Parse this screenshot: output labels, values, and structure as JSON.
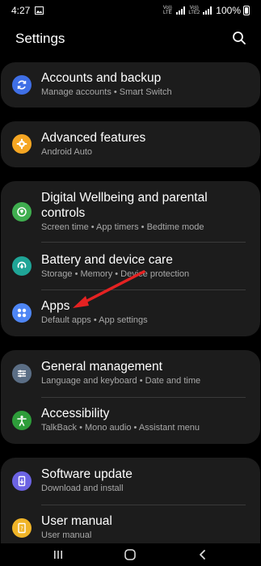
{
  "status": {
    "time": "4:27",
    "net1": "Vo)) LTE",
    "net2": "Vo)) LTE2",
    "battery": "100%"
  },
  "header": {
    "title": "Settings"
  },
  "items": {
    "accounts": {
      "title": "Accounts and backup",
      "subtitle": "Manage accounts  •  Smart Switch",
      "color": "#3f6fe6"
    },
    "advanced": {
      "title": "Advanced features",
      "subtitle": "Android Auto",
      "color": "#f5a623"
    },
    "wellbeing": {
      "title1": "Digital Wellbeing and parental",
      "title2": "controls",
      "subtitle": "Screen time  •  App timers  •  Bedtime mode",
      "color": "#3fae4f"
    },
    "battery": {
      "title": "Battery and device care",
      "subtitle": "Storage  •  Memory  •  Device protection",
      "color": "#1fa597"
    },
    "apps": {
      "title": "Apps",
      "subtitle": "Default apps  •  App settings",
      "color": "#4e86f5"
    },
    "general": {
      "title": "General management",
      "subtitle": "Language and keyboard  •  Date and time",
      "color": "#5b6e85"
    },
    "accessibility": {
      "title": "Accessibility",
      "subtitle": "TalkBack  •  Mono audio  •  Assistant menu",
      "color": "#2e9d3a"
    },
    "software": {
      "title": "Software update",
      "subtitle": "Download and install",
      "color": "#6c63e3"
    },
    "manual": {
      "title": "User manual",
      "subtitle": "User manual",
      "color": "#f0b428"
    }
  },
  "annotation": {
    "arrow_color": "#e52222"
  }
}
